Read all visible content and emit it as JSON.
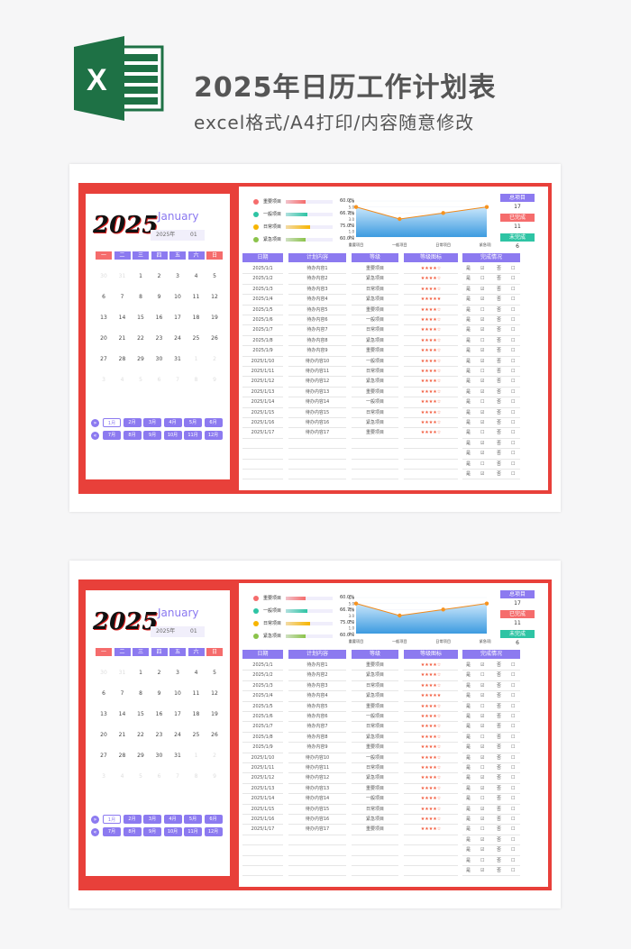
{
  "header": {
    "title": "2025年日历工作计划表",
    "subtitle": "excel格式/A4打印/内容随意修改",
    "logo_letter": "X"
  },
  "colors": {
    "red": "#e8403a",
    "purple": "#8c7af0",
    "pink": "#f56c6c",
    "teal": "#2ec4a4",
    "orange": "#f7a21b",
    "green": "#8bc34a"
  },
  "calendar": {
    "year_logo": "2025",
    "month_name": "January",
    "year_label": "2025年",
    "month_value": "01",
    "weekdays": [
      "一",
      "二",
      "三",
      "四",
      "五",
      "六",
      "日"
    ],
    "weeks": [
      [
        "30",
        "31",
        "1",
        "2",
        "3",
        "4",
        "5"
      ],
      [
        "6",
        "7",
        "8",
        "9",
        "10",
        "11",
        "12"
      ],
      [
        "13",
        "14",
        "15",
        "16",
        "17",
        "18",
        "19"
      ],
      [
        "20",
        "21",
        "22",
        "23",
        "24",
        "25",
        "26"
      ],
      [
        "27",
        "28",
        "29",
        "30",
        "31",
        "1",
        "2"
      ],
      [
        "3",
        "4",
        "5",
        "6",
        "7",
        "8",
        "9"
      ]
    ],
    "months_row1": [
      "1月",
      "2月",
      "3月",
      "4月",
      "5月",
      "6月"
    ],
    "months_row2": [
      "7月",
      "8月",
      "9月",
      "10月",
      "11月",
      "12月"
    ],
    "selected_month": "1月",
    "next_icon": "»",
    "prev_icon": "«"
  },
  "legend": [
    {
      "label": "重要项目",
      "pct": "60.0%",
      "value": 60,
      "color": "#f56c6c"
    },
    {
      "label": "一般项目",
      "pct": "66.7%",
      "value": 66.7,
      "color": "#2ec4a4"
    },
    {
      "label": "日常项目",
      "pct": "75.0%",
      "value": 75,
      "color": "#f7b500"
    },
    {
      "label": "紧急项目",
      "pct": "60.0%",
      "value": 60,
      "color": "#8bc34a"
    }
  ],
  "chart_data": {
    "type": "area",
    "categories": [
      "重要项目",
      "一般项目",
      "日常项目",
      "紧急项目"
    ],
    "values": [
      5,
      3,
      4,
      5
    ],
    "ylim": [
      0,
      6
    ],
    "yticks": [
      "0.0",
      "1.0",
      "2.0",
      "3.0",
      "4.0",
      "5.0",
      "6.0"
    ],
    "grid": true
  },
  "stats": {
    "total_label": "总项目",
    "total": "17",
    "done_label": "已完成",
    "done": "11",
    "undone_label": "未完成",
    "undone": "6"
  },
  "table": {
    "headers": [
      "日期",
      "计划内容",
      "等级",
      "等级图标",
      "完成情况"
    ],
    "yes": "是",
    "no": "否",
    "rows": [
      [
        "2025/1/1",
        "待办内容1",
        "重要项目",
        "★★★★☆",
        true
      ],
      [
        "2025/1/2",
        "待办内容2",
        "紧急项目",
        "★★★★☆",
        false
      ],
      [
        "2025/1/3",
        "待办内容3",
        "日常项目",
        "★★★★☆",
        true
      ],
      [
        "2025/1/4",
        "待办内容4",
        "紧急项目",
        "★★★★★",
        true
      ],
      [
        "2025/1/5",
        "待办内容5",
        "重要项目",
        "★★★★☆",
        false
      ],
      [
        "2025/1/6",
        "待办内容6",
        "一般项目",
        "★★★★☆",
        true
      ],
      [
        "2025/1/7",
        "待办内容7",
        "日常项目",
        "★★★★☆",
        true
      ],
      [
        "2025/1/8",
        "待办内容8",
        "紧急项目",
        "★★★★☆",
        false
      ],
      [
        "2025/1/9",
        "待办内容9",
        "重要项目",
        "★★★★☆",
        true
      ],
      [
        "2025/1/10",
        "待办内容10",
        "一般项目",
        "★★★★☆",
        true
      ],
      [
        "2025/1/11",
        "待办内容11",
        "日常项目",
        "★★★★☆",
        false
      ],
      [
        "2025/1/12",
        "待办内容12",
        "紧急项目",
        "★★★★☆",
        true
      ],
      [
        "2025/1/13",
        "待办内容13",
        "重要项目",
        "★★★★☆",
        true
      ],
      [
        "2025/1/14",
        "待办内容14",
        "一般项目",
        "★★★★☆",
        false
      ],
      [
        "2025/1/15",
        "待办内容15",
        "日常项目",
        "★★★★☆",
        true
      ],
      [
        "2025/1/16",
        "待办内容16",
        "紧急项目",
        "★★★★☆",
        true
      ],
      [
        "2025/1/17",
        "待办内容17",
        "重要项目",
        "★★★★☆",
        false
      ],
      [
        "",
        "",
        "",
        "",
        true
      ],
      [
        "",
        "",
        "",
        "",
        true
      ],
      [
        "",
        "",
        "",
        "",
        false
      ],
      [
        "",
        "",
        "",
        "",
        true
      ]
    ]
  }
}
